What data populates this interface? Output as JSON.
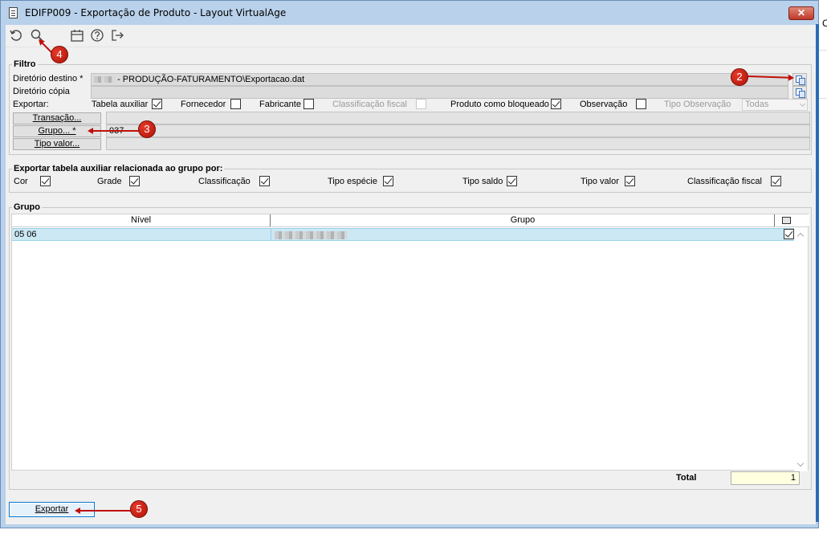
{
  "window": {
    "title": "EDIFP009 - Exportação de Produto - Layout VirtualAge",
    "close_label": "✕"
  },
  "toolbar": {
    "icons": [
      "refresh-icon",
      "search-icon",
      "calendar-icon",
      "help-icon",
      "exit-icon"
    ]
  },
  "filtro": {
    "title": "Filtro",
    "diretorio_destino_label": "Diretório destino *",
    "diretorio_destino_value": "- PRODUÇÃO-FATURAMENTO\\Exportacao.dat",
    "diretorio_copia_label": "Diretório cópia",
    "diretorio_copia_value": "",
    "exportar_label": "Exportar:",
    "options": {
      "tabela_auxiliar": {
        "label": "Tabela auxiliar",
        "checked": true
      },
      "fornecedor": {
        "label": "Fornecedor",
        "checked": false
      },
      "fabricante": {
        "label": "Fabricante",
        "checked": false
      },
      "classificacao_fiscal": {
        "label": "Classificação fiscal",
        "checked": false,
        "disabled": true
      },
      "produto_bloqueado": {
        "label": "Produto como bloqueado",
        "checked": true
      },
      "observacao": {
        "label": "Observação",
        "checked": false
      }
    },
    "tipo_observacao_label": "Tipo Observação",
    "tipo_observacao_value": "Todas",
    "transacao_button": "Transação...",
    "grupo_button": "Grupo... *",
    "grupo_value": "037",
    "tipo_valor_button": "Tipo valor..."
  },
  "aux": {
    "title": "Exportar tabela auxiliar relacionada ao grupo por:",
    "items": [
      {
        "label": "Cor",
        "checked": true
      },
      {
        "label": "Grade",
        "checked": true
      },
      {
        "label": "Classificação",
        "checked": true
      },
      {
        "label": "Tipo espécie",
        "checked": true
      },
      {
        "label": "Tipo saldo",
        "checked": true
      },
      {
        "label": "Tipo valor",
        "checked": true
      },
      {
        "label": "Classificação fiscal",
        "checked": true
      }
    ]
  },
  "grupo": {
    "title": "Grupo",
    "columns": [
      "Nível",
      "Grupo"
    ],
    "rows": [
      {
        "nivel": "05 06",
        "grupo": "",
        "checked": true
      }
    ]
  },
  "total": {
    "label": "Total",
    "value": "1"
  },
  "exportar_button": "Exportar",
  "annotations": [
    "2",
    "3",
    "4",
    "5"
  ]
}
